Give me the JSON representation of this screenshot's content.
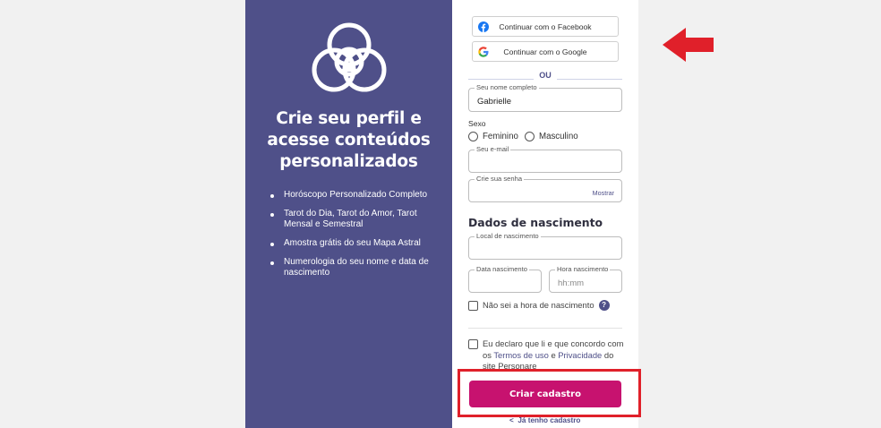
{
  "left_panel": {
    "headline_lines": [
      "Crie seu perfil e",
      "acesse conteúdos",
      "personalizados"
    ],
    "features": [
      "Horóscopo Personalizado Completo",
      "Tarot do Dia, Tarot do Amor, Tarot Mensal e Semestral",
      "Amostra grátis do seu Mapa Astral",
      "Numerologia do seu nome e data de nascimento"
    ]
  },
  "form": {
    "facebook_label": "Continuar com o Facebook",
    "google_label": "Continuar com o Google",
    "divider_text": "OU",
    "name": {
      "label": "Seu nome completo",
      "value": "Gabrielle"
    },
    "sexo_label": "Sexo",
    "sexo_options": [
      "Feminino",
      "Masculino"
    ],
    "email": {
      "label": "Seu e-mail",
      "value": ""
    },
    "password": {
      "label": "Crie sua senha",
      "value": "",
      "toggle": "Mostrar"
    },
    "birth_section_title": "Dados de nascimento",
    "birth_place": {
      "label": "Local de nascimento",
      "value": ""
    },
    "birth_date": {
      "label": "Data nascimento",
      "value": ""
    },
    "birth_time": {
      "label": "Hora nascimento",
      "placeholder": "hh:mm"
    },
    "unknown_time_label": "Não sei a hora de nascimento",
    "help_symbol": "?",
    "terms": {
      "prefix": "Eu declaro que li e que concordo com os",
      "terms_link": "Termos de uso",
      "conjunction": "e",
      "privacy_link": "Privacidade",
      "suffix": "do site Personare"
    },
    "submit_label": "Criar cadastro",
    "login_link": "Já tenho cadastro",
    "login_chevron": "<"
  },
  "colors": {
    "panel_purple": "#4f5089",
    "submit_magenta": "#c7126f",
    "annotation_red": "#e0202a"
  }
}
